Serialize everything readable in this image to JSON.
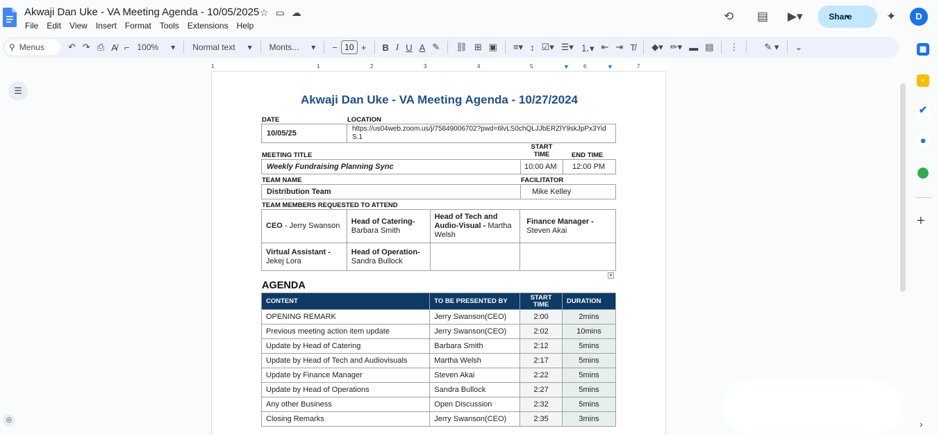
{
  "window": {
    "title": "Akwaji Dan Uke - VA Meeting Agenda - 10/05/2025",
    "menu": [
      "File",
      "Edit",
      "View",
      "Insert",
      "Format",
      "Tools",
      "Extensions",
      "Help"
    ],
    "share_label": "Share",
    "avatar_letter": "D"
  },
  "toolbar": {
    "menus_label": "Menus",
    "zoom": "100%",
    "style": "Normal text",
    "font": "Monts...",
    "font_size": "10"
  },
  "ruler": {
    "numbers": [
      "1",
      "1",
      "2",
      "3",
      "4",
      "5",
      "6",
      "7"
    ]
  },
  "doc": {
    "heading": "Akwaji Dan Uke - VA Meeting Agenda - 10/27/2024",
    "date_label": "DATE",
    "date_value": "10/05/25",
    "location_label": "LOCATION",
    "location_value": "https://us04web.zoom.us/j/75849006702?pwd=6lvLS0chQLJJbERZlY9skJpPx3YidS.1",
    "meeting_title_label": "MEETING TITLE",
    "meeting_title_value": "Weekly Fundraising Planning Sync",
    "start_time_label": "START TIME",
    "start_time_value": "10:00 AM",
    "end_time_label": "END TIME",
    "end_time_value": "12:00 PM",
    "team_name_label": "TEAM NAME",
    "team_name_value": "Distribution Team",
    "facilitator_label": "FACILITATOR",
    "facilitator_value": "Mike Kelley",
    "members_label": "TEAM MEMBERS REQUESTED TO ATTEND",
    "members": [
      {
        "role": "CEO",
        "sep": " - ",
        "name": "Jerry Swanson"
      },
      {
        "role": "Head of Catering-",
        "sep": " ",
        "name": "Barbara Smith"
      },
      {
        "role": "Head of Tech and Audio-Visual -",
        "sep": " ",
        "name": "Martha Welsh"
      },
      {
        "role": "Finance Manager -",
        "sep": " ",
        "name": "Steven Akai"
      },
      {
        "role": "Virtual Assistant -",
        "sep": " ",
        "name": "Jekej Lora"
      },
      {
        "role": "Head of Operation-",
        "sep": " ",
        "name": "Sandra Bullock"
      }
    ],
    "agenda_heading": "AGENDA",
    "agenda_columns": [
      "CONTENT",
      "TO BE PRESENTED BY",
      "START TIME",
      "DURATION"
    ],
    "agenda_rows": [
      {
        "content": "OPENING REMARK",
        "presenter": "Jerry Swanson(CEO)",
        "start": "2:00",
        "duration": "2mins"
      },
      {
        "content": "Previous meeting action item update",
        "presenter": "Jerry Swanson(CEO)",
        "start": "2:02",
        "duration": "10mins"
      },
      {
        "content": "Update by Head of Catering",
        "presenter": "Barbara Smith",
        "start": "2:12",
        "duration": "5mins"
      },
      {
        "content": "Update by Head of Tech and Audiovisuals",
        "presenter": "Martha Welsh",
        "start": "2:17",
        "duration": "5mins"
      },
      {
        "content": "Update by Finance Manager",
        "presenter": "Steven Akai",
        "start": "2:22",
        "duration": "5mins"
      },
      {
        "content": "Update by Head of Operations",
        "presenter": "Sandra Bullock",
        "start": "2:27",
        "duration": "5mins"
      },
      {
        "content": "Any other Business",
        "presenter": "Open Discussion",
        "start": "2:32",
        "duration": "5mins"
      },
      {
        "content": "Closing Remarks",
        "presenter": "Jerry Swanson(CEO)",
        "start": "2:35",
        "duration": "3mins"
      }
    ]
  },
  "colors": {
    "heading_blue": "#1f4e8c",
    "table_header": "#0e3a66",
    "share_button": "#c2e7ff",
    "avatar": "#1a73e8"
  }
}
